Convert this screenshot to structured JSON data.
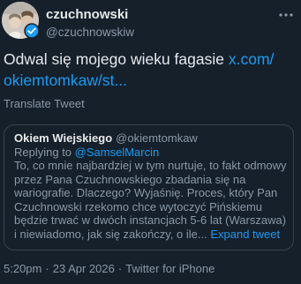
{
  "author": {
    "name": "czuchnowski",
    "handle": "@czuchnowskiw",
    "avatar_icon": "profile-photo",
    "verified_icon": "verified-badge-icon"
  },
  "tweet": {
    "text": "Odwal się mojego wieku fagasie",
    "link_line1": "x.com/",
    "link_line2": "okiemtomkaw/st...",
    "translate_label": "Translate Tweet"
  },
  "quoted": {
    "name": "Okiem Wiejskiego",
    "handle": "@okiemtomkaw",
    "replying_prefix": "Replying to",
    "replying_handle": "@SamselMarcin",
    "body": "To, co mnie najbardziej w tym nurtuje, to fakt odmowy przez Pana Czuchnowskiego zbadania się na wariografie. Dlaczego? Wyjaśnię. Proces, który Pan Czuchnowski rzekomo chce wytoczyć Pińskiemu będzie trwać w dwóch instancjach 5-6 lat (Warszawa) i niewiadomo, jak się zakończy, o ile...",
    "expand_label": "Expand tweet"
  },
  "meta": {
    "time": "5:20pm",
    "date": "23 Apr 2026",
    "source": "Twitter for iPhone"
  },
  "colors": {
    "background": "#15202b",
    "link": "#1d9bf0",
    "muted": "#8b98a5",
    "border": "#38444d"
  }
}
